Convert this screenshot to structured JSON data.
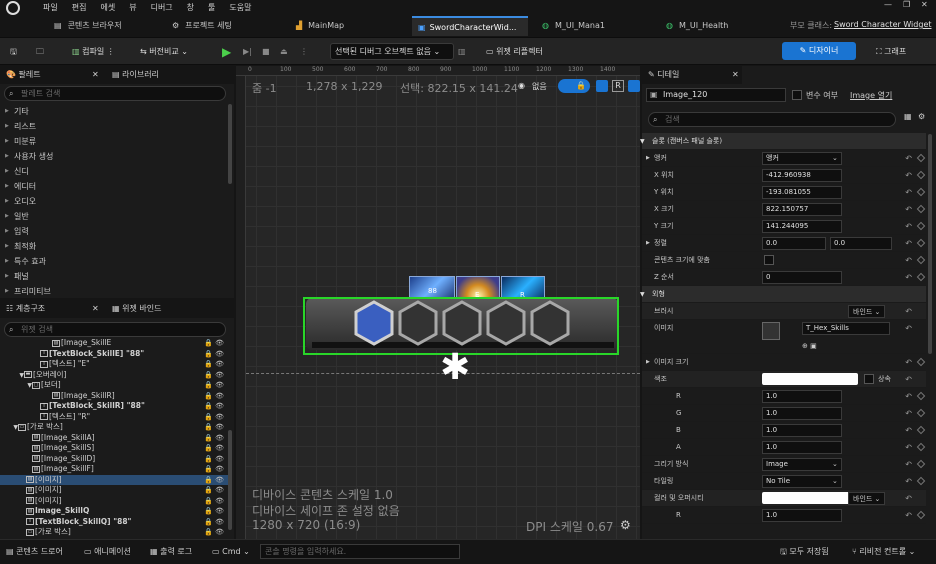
{
  "menu": [
    "파일",
    "편집",
    "에셋",
    "뷰",
    "디버그",
    "창",
    "툴",
    "도움말"
  ],
  "tabs": [
    {
      "label": "콘텐츠 브라우저",
      "icon": "folder-icon"
    },
    {
      "label": "프로젝트 세팅",
      "icon": "gear-icon"
    },
    {
      "label": "MainMap",
      "icon": "level-icon"
    },
    {
      "label": "SwordCharacterWid...",
      "icon": "widget-icon",
      "active": true
    },
    {
      "label": "M_UI_Mana1",
      "icon": "material-icon"
    },
    {
      "label": "M_UI_Health",
      "icon": "material-icon"
    }
  ],
  "parent_class": {
    "label": "부모 클래스:",
    "value": "Sword Character Widget"
  },
  "toolbar": {
    "compile": "컴파일",
    "diff": "버전비교",
    "selected_debug": "선택된 디버그 오브젝트 없음",
    "widget_reflector": "위젯 리플렉터",
    "designer": "디자이너",
    "graph": "그래프"
  },
  "palette": {
    "tab": "팔레트",
    "library_tab": "라이브러리",
    "search_placeholder": "팔레트 검색",
    "items": [
      "기타",
      "리스트",
      "미분류",
      "사용자 생성",
      "신디",
      "에디터",
      "오디오",
      "일반",
      "입력",
      "최적화",
      "특수 효과",
      "패널",
      "프리미티브"
    ]
  },
  "hierarchy": {
    "tab": "계층구조",
    "binding_tab": "위젯 바인드",
    "search_placeholder": "위젯 검색",
    "rows": [
      {
        "indent": 52,
        "label": "[Image_SkillE",
        "icon": "image"
      },
      {
        "indent": 40,
        "label": "[TextBlock_SkillE] \"88\"",
        "icon": "text",
        "bold": true
      },
      {
        "indent": 40,
        "label": "[텍스트] \"E\"",
        "icon": "text"
      },
      {
        "indent": 24,
        "label": "[오버레이]",
        "icon": "overlay",
        "caret": "▼"
      },
      {
        "indent": 32,
        "label": "[보더]",
        "icon": "border",
        "caret": "▼"
      },
      {
        "indent": 52,
        "label": "[Image_SkillR]",
        "icon": "image"
      },
      {
        "indent": 40,
        "label": "[TextBlock_SkillR] \"88\"",
        "icon": "text",
        "bold": true
      },
      {
        "indent": 40,
        "label": "[텍스트] \"R\"",
        "icon": "text"
      },
      {
        "indent": 18,
        "label": "[가로 박스]",
        "icon": "hbox",
        "caret": "▼"
      },
      {
        "indent": 32,
        "label": "[Image_SkillA]",
        "icon": "image"
      },
      {
        "indent": 32,
        "label": "[Image_SkillS]",
        "icon": "image"
      },
      {
        "indent": 32,
        "label": "[Image_SkillD]",
        "icon": "image"
      },
      {
        "indent": 32,
        "label": "[Image_SkillF]",
        "icon": "image"
      },
      {
        "indent": 26,
        "label": "[이미지]",
        "icon": "image",
        "selected": true
      },
      {
        "indent": 26,
        "label": "[이미지]",
        "icon": "image"
      },
      {
        "indent": 26,
        "label": "[이미지]",
        "icon": "image"
      },
      {
        "indent": 26,
        "label": "Image_SkillQ",
        "icon": "image",
        "bold": true
      },
      {
        "indent": 26,
        "label": "[TextBlock_SkillQ] \"88\"",
        "icon": "text",
        "bold": true
      },
      {
        "indent": 26,
        "label": "[가로 박스]",
        "icon": "hbox"
      }
    ]
  },
  "designer": {
    "zoom": "줌 -1",
    "size": "1,278 x 1,229",
    "selection": "선택: 822.15 x 141.24",
    "none": "없음",
    "r_label": "R",
    "ruler": [
      "0",
      "100",
      "500",
      "600",
      "700",
      "800",
      "900",
      "1000",
      "1100",
      "1200",
      "1300",
      "1400"
    ],
    "device_scale": "디바이스 콘텐츠 스케일 1.0",
    "safe_zone": "디바이스 세이프 존 설정 없음",
    "resolution": "1280 x 720 (16:9)",
    "dpi": "DPI 스케일 0.67",
    "skill_numbers": [
      "88",
      "E",
      "R"
    ]
  },
  "details": {
    "tab": "디테일",
    "name": "Image_120",
    "is_variable": "변수 여부",
    "open_image": "Image 열기",
    "search_placeholder": "검색",
    "rows": [
      {
        "type": "section",
        "label": "슬롯 (캔버스 패널 슬롯)"
      },
      {
        "label": "앵커",
        "value": "앵커",
        "dropdown": true,
        "caret": true
      },
      {
        "label": "X 위치",
        "value": "-412.960938"
      },
      {
        "label": "Y 위치",
        "value": "-193.081055"
      },
      {
        "label": "X 크기",
        "value": "822.150757"
      },
      {
        "label": "Y 크기",
        "value": "141.244095"
      },
      {
        "label": "정렬",
        "value": "0.0",
        "value2": "0.0",
        "caret": true
      },
      {
        "label": "콘텐츠 크기에 맞춤",
        "checkbox": true
      },
      {
        "label": "Z 순서",
        "value": "0"
      },
      {
        "type": "section",
        "label": "외형"
      },
      {
        "label": "브러시",
        "bind": "바인드",
        "subsection": true
      },
      {
        "label": "이미지",
        "asset": "T_Hex_Skills",
        "tall": true
      },
      {
        "label": "이미지 크기",
        "caret": true
      },
      {
        "label": "색조",
        "color": true,
        "inherit": "상속",
        "subsection": true
      },
      {
        "label": "R",
        "value": "1.0"
      },
      {
        "label": "G",
        "value": "1.0"
      },
      {
        "label": "B",
        "value": "1.0"
      },
      {
        "label": "A",
        "value": "1.0"
      },
      {
        "label": "그리기 방식",
        "value": "Image",
        "dropdown": true
      },
      {
        "label": "타일링",
        "value": "No Tile",
        "dropdown": true
      },
      {
        "label": "컬러 및 오퍼시티",
        "color": true,
        "bind": "바인드",
        "subsection": true
      },
      {
        "label": "R",
        "value": "1.0"
      }
    ]
  },
  "bottom": {
    "content_drawer": "콘텐츠 드로어",
    "animation": "애니메이션",
    "output_log": "출력 로그",
    "cmd": "Cmd",
    "console_placeholder": "콘솔 명령을 입력하세요.",
    "save_all": "모두 저장됨",
    "revision": "리비전 컨트롤"
  },
  "colors": {
    "accent": "#1a74d2",
    "selection_green": "#29d629",
    "selected_row": "#2a4d74"
  }
}
